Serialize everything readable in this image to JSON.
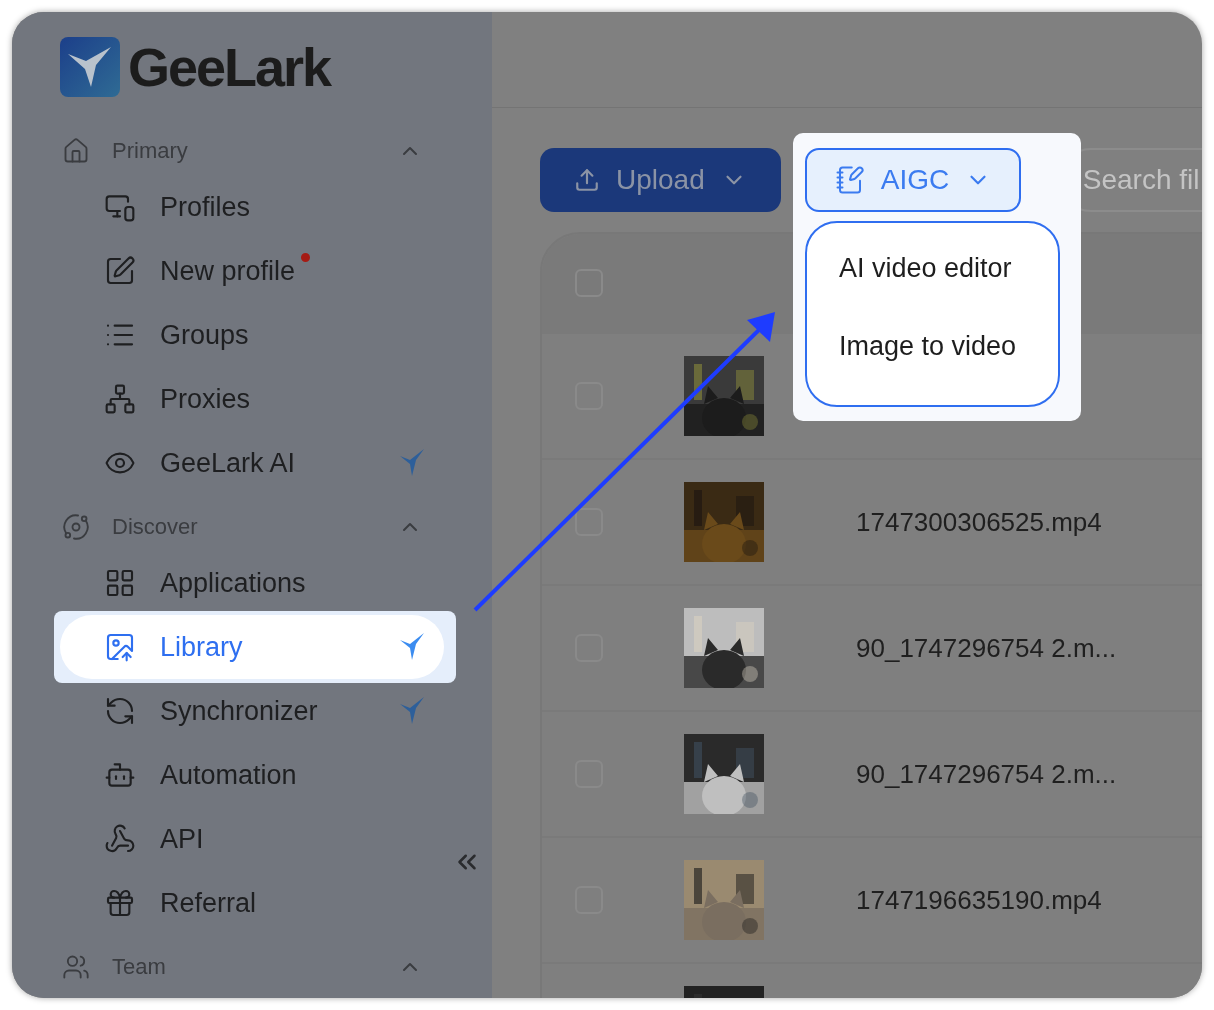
{
  "brand": {
    "name": "GeeLark"
  },
  "sidebar": {
    "sections": [
      {
        "title": "Primary",
        "expanded": true,
        "items": [
          {
            "label": "Profiles",
            "selected": false,
            "dot": false,
            "ai_badge": false
          },
          {
            "label": "New profile",
            "selected": false,
            "dot": true,
            "ai_badge": false
          },
          {
            "label": "Groups",
            "selected": false,
            "dot": false,
            "ai_badge": false
          },
          {
            "label": "Proxies",
            "selected": false,
            "dot": false,
            "ai_badge": false
          },
          {
            "label": "GeeLark AI",
            "selected": false,
            "dot": false,
            "ai_badge": true
          }
        ]
      },
      {
        "title": "Discover",
        "expanded": true,
        "items": [
          {
            "label": "Applications",
            "selected": false,
            "dot": false,
            "ai_badge": false
          },
          {
            "label": "Library",
            "selected": true,
            "dot": false,
            "ai_badge": true
          },
          {
            "label": "Synchronizer",
            "selected": false,
            "dot": false,
            "ai_badge": true
          },
          {
            "label": "Automation",
            "selected": false,
            "dot": false,
            "ai_badge": false
          },
          {
            "label": "API",
            "selected": false,
            "dot": false,
            "ai_badge": false
          },
          {
            "label": "Referral",
            "selected": false,
            "dot": false,
            "ai_badge": false
          }
        ]
      },
      {
        "title": "Team",
        "expanded": true
      }
    ]
  },
  "toolbar": {
    "upload": {
      "label": "Upload"
    },
    "aigc": {
      "label": "AIGC",
      "open": true
    },
    "search": {
      "placeholder": "Search fil"
    }
  },
  "aigc_menu": {
    "items": [
      "AI video editor",
      "Image to video"
    ]
  },
  "table": {
    "header": {
      "checked": false
    },
    "rows": [
      {
        "checked": false
      },
      {
        "checked": false,
        "file_name": "1747300306525.mp4"
      },
      {
        "checked": false,
        "file_name": "90_1747296754 2.m..."
      },
      {
        "checked": false,
        "file_name": "90_1747296754 2.m..."
      },
      {
        "checked": false,
        "file_name": "1747196635190.mp4"
      },
      {}
    ]
  }
}
